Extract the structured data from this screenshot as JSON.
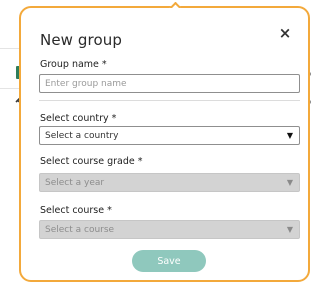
{
  "modal": {
    "title": "New group",
    "close_label": "×"
  },
  "form": {
    "group_name": {
      "label": "Group name *",
      "placeholder": "Enter group name",
      "value": ""
    },
    "country": {
      "label": "Select country *",
      "value": "Select a country",
      "state": "enabled"
    },
    "course_grade": {
      "label": "Select course grade *",
      "value": "Select a year",
      "state": "disabled"
    },
    "course": {
      "label": "Select course *",
      "value": "Select a course",
      "state": "disabled"
    },
    "caret": "▼"
  },
  "actions": {
    "save_label": "Save"
  },
  "colors": {
    "modal_border": "#f3a93b",
    "save_button": "#8fc8bd",
    "disabled_field": "#d3d3d3"
  }
}
